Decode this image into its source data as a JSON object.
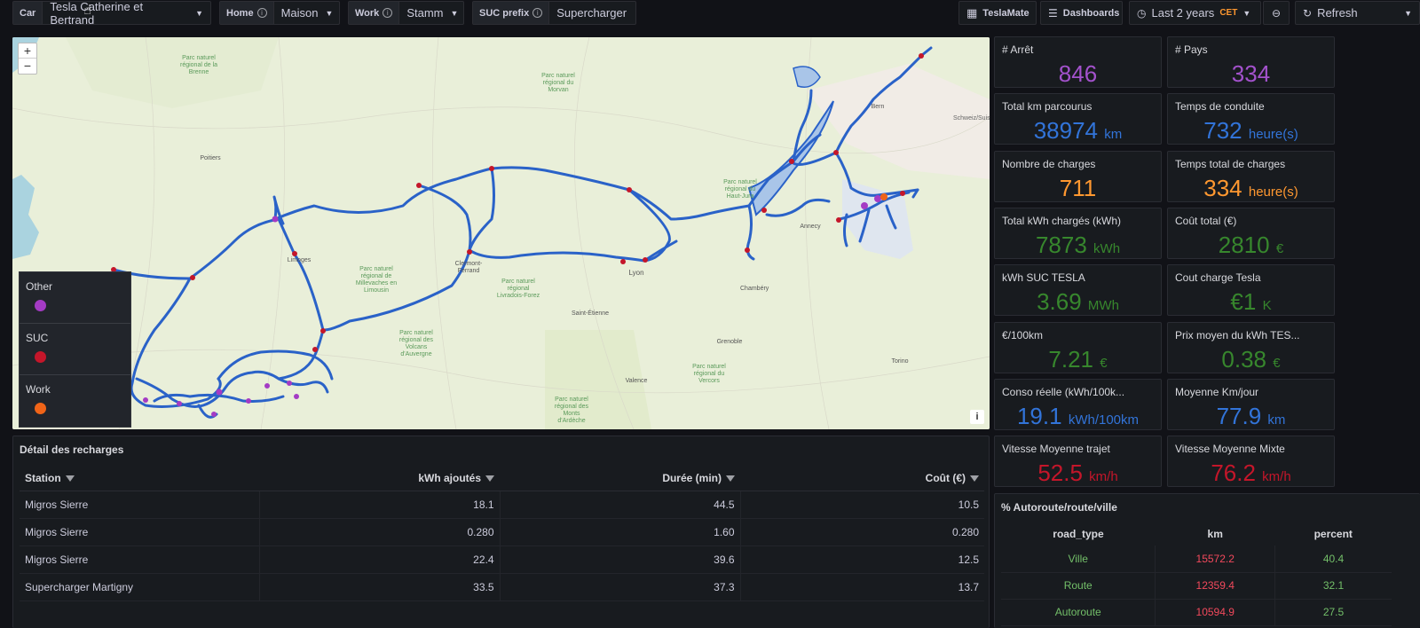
{
  "topbar": {
    "car": {
      "label": "Car",
      "value": "Tesla Catherine et Bertrand"
    },
    "home": {
      "label": "Home",
      "value": "Maison"
    },
    "work": {
      "label": "Work",
      "value": "Stamm"
    },
    "suc": {
      "label": "SUC prefix",
      "value": "Supercharger"
    },
    "teslamate": "TeslaMate",
    "dashboards": "Dashboards",
    "time_range": "Last 2 years",
    "timezone": "CET",
    "refresh": "Refresh"
  },
  "map": {
    "zoom_in": "+",
    "zoom_out": "−",
    "info": "i",
    "legend": [
      {
        "label": "Other",
        "color": "#a43bc4"
      },
      {
        "label": "SUC",
        "color": "#c4162a"
      },
      {
        "label": "Work",
        "color": "#f06418"
      }
    ],
    "labels": [
      "Parc naturel régional de la Brenne",
      "Parc naturel régional du Morvan",
      "Parc naturel régional du Haut-Jura",
      "Parc naturel régional de Millevaches en Limousin",
      "Parc naturel régional des Volcans d'Auvergne",
      "Parc naturel régional Livradois-Forez",
      "Parc naturel régional du Vercors",
      "Parc naturel régional des Monts d'Ardèche",
      "Schweiz/Suisse/Svizzera",
      "Lyon",
      "Clermont-Ferrand",
      "Limoges",
      "Saint-Étienne",
      "Poitiers",
      "Torino",
      "Bern",
      "Annecy",
      "Valence",
      "Grenoble",
      "Chambéry"
    ]
  },
  "stats": [
    {
      "title": "# Arrêt",
      "value": "846",
      "unit": "",
      "color": "#a352cc"
    },
    {
      "title": "# Pays",
      "value": "334",
      "unit": "",
      "color": "#a352cc"
    },
    {
      "title": "Total km parcourus",
      "value": "38974",
      "unit": "km",
      "color": "#3274d9"
    },
    {
      "title": "Temps de conduite",
      "value": "732",
      "unit": "heure(s)",
      "color": "#3274d9"
    },
    {
      "title": "Nombre de charges",
      "value": "711",
      "unit": "",
      "color": "#ff9830"
    },
    {
      "title": "Temps total de charges",
      "value": "334",
      "unit": "heure(s)",
      "color": "#ff9830"
    },
    {
      "title": "Total kWh chargés (kWh)",
      "value": "7873",
      "unit": "kWh",
      "color": "#37872d"
    },
    {
      "title": "Coût total (€)",
      "value": "2810",
      "unit": "€",
      "color": "#37872d"
    },
    {
      "title": "kWh SUC TESLA",
      "value": "3.69",
      "unit": "MWh",
      "color": "#37872d"
    },
    {
      "title": "Cout charge Tesla",
      "value": "€1",
      "unit": "K",
      "color": "#37872d"
    },
    {
      "title": "€/100km",
      "value": "7.21",
      "unit": "€",
      "color": "#37872d"
    },
    {
      "title": "Prix moyen du kWh TES...",
      "value": "0.38",
      "unit": "€",
      "color": "#37872d"
    },
    {
      "title": "Conso réelle (kWh/100k...",
      "value": "19.1",
      "unit": "kWh/100km",
      "color": "#3274d9"
    },
    {
      "title": "Moyenne Km/jour",
      "value": "77.9",
      "unit": "km",
      "color": "#3274d9"
    },
    {
      "title": "Vitesse Moyenne trajet",
      "value": "52.5",
      "unit": "km/h",
      "color": "#c4162a"
    },
    {
      "title": "Vitesse Moyenne Mixte",
      "value": "76.2",
      "unit": "km/h",
      "color": "#c4162a"
    }
  ],
  "detail": {
    "title": "Détail des recharges",
    "columns": [
      "Station",
      "kWh ajoutés",
      "Durée (min)",
      "Coût (€)"
    ],
    "rows": [
      [
        "Migros Sierre",
        "18.1",
        "44.5",
        "10.5"
      ],
      [
        "Migros Sierre",
        "0.280",
        "1.60",
        "0.280"
      ],
      [
        "Migros Sierre",
        "22.4",
        "39.6",
        "12.5"
      ],
      [
        "Supercharger Martigny",
        "33.5",
        "37.3",
        "13.7"
      ]
    ]
  },
  "road": {
    "title": "% Autoroute/route/ville",
    "columns": [
      "road_type",
      "km",
      "percent"
    ],
    "rows": [
      [
        "Ville",
        "15572.2",
        "40.4"
      ],
      [
        "Route",
        "12359.4",
        "32.1"
      ],
      [
        "Autoroute",
        "10594.9",
        "27.5"
      ]
    ],
    "colors": {
      "road_type": "#73bf69",
      "km": "#f2495c",
      "percent": "#73bf69"
    }
  }
}
